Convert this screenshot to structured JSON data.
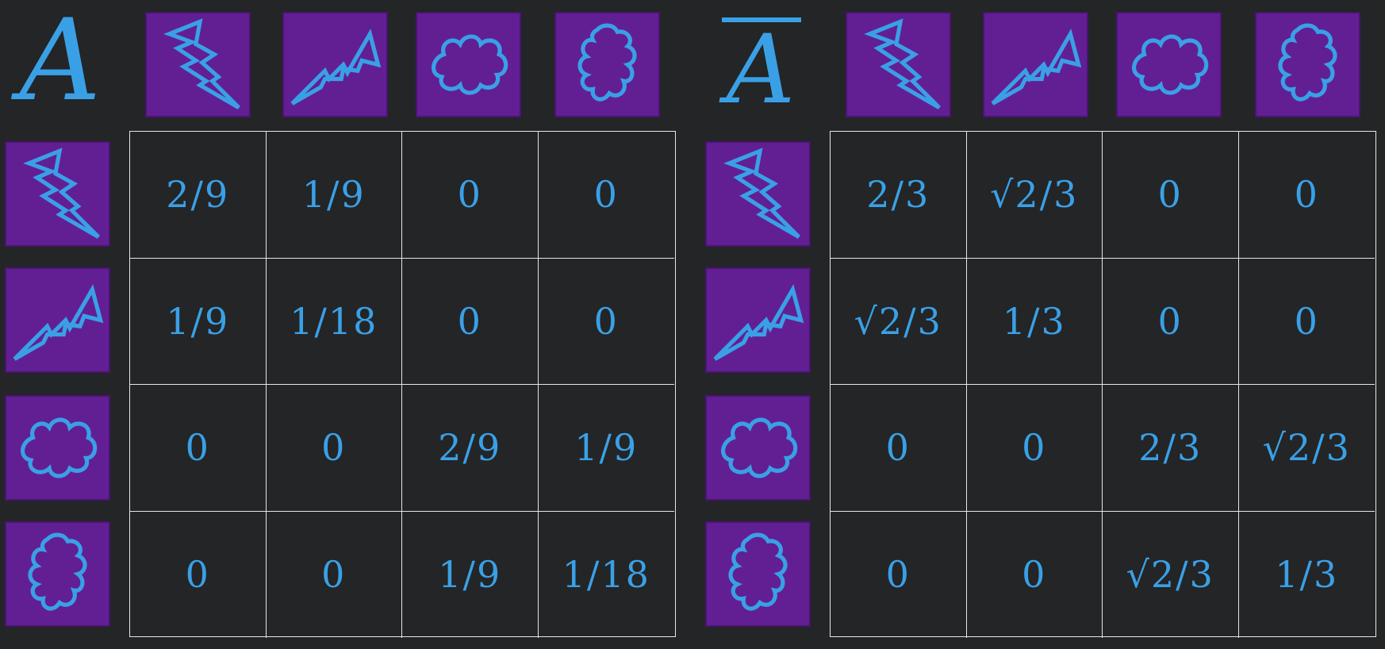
{
  "colors": {
    "background": "#232527",
    "tile": "#621f94",
    "ink": "#3aa0e6",
    "grid": "#e6e6e6"
  },
  "icons": [
    "lightning-bolt-icon",
    "lightning-zigzag-icon",
    "cloud-icon",
    "cloud-tall-icon"
  ],
  "matrix_a": {
    "symbol": "A",
    "rows": [
      [
        "2/9",
        "1/9",
        "0",
        "0"
      ],
      [
        "1/9",
        "1/18",
        "0",
        "0"
      ],
      [
        "0",
        "0",
        "2/9",
        "1/9"
      ],
      [
        "0",
        "0",
        "1/9",
        "1/18"
      ]
    ]
  },
  "matrix_abar": {
    "symbol": "A",
    "rows": [
      [
        "2/3",
        "√2/3",
        "0",
        "0"
      ],
      [
        "√2/3",
        "1/3",
        "0",
        "0"
      ],
      [
        "0",
        "0",
        "2/3",
        "√2/3"
      ],
      [
        "0",
        "0",
        "√2/3",
        "1/3"
      ]
    ]
  }
}
